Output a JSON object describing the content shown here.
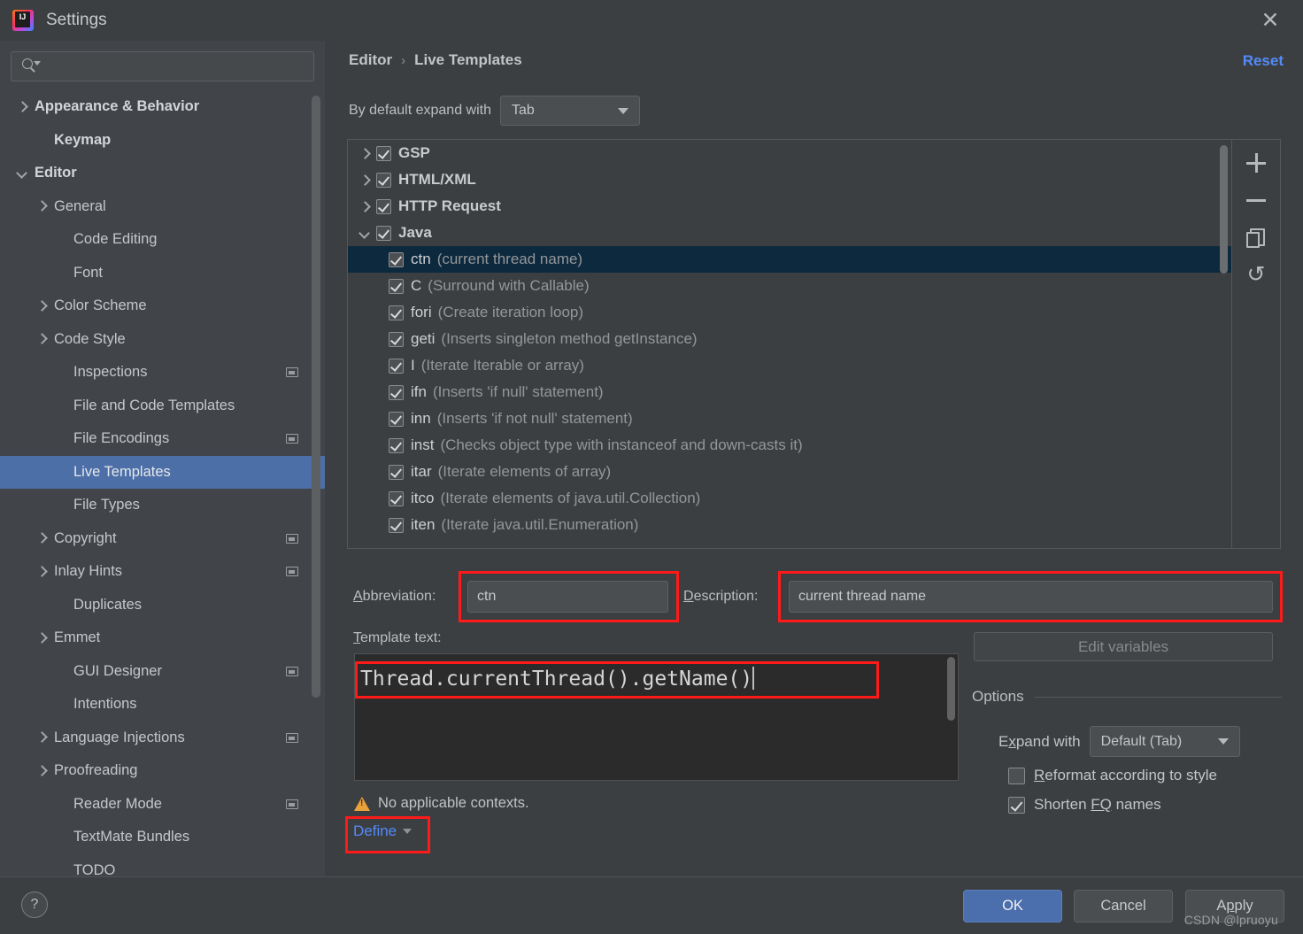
{
  "window": {
    "title": "Settings",
    "logo_text": "IJ",
    "close_icon": "✕"
  },
  "sidebar": {
    "search": {
      "value": "",
      "placeholder": ""
    },
    "items": [
      {
        "label": "Appearance & Behavior",
        "arrow": "right",
        "bold": true,
        "indent": 0,
        "badge": false,
        "selected": false
      },
      {
        "label": "Keymap",
        "arrow": "none",
        "bold": true,
        "indent": 1,
        "badge": false,
        "selected": false
      },
      {
        "label": "Editor",
        "arrow": "down",
        "bold": true,
        "indent": 0,
        "badge": false,
        "selected": false
      },
      {
        "label": "General",
        "arrow": "right",
        "bold": false,
        "indent": 1,
        "badge": false,
        "selected": false
      },
      {
        "label": "Code Editing",
        "arrow": "none",
        "bold": false,
        "indent": 2,
        "badge": false,
        "selected": false
      },
      {
        "label": "Font",
        "arrow": "none",
        "bold": false,
        "indent": 2,
        "badge": false,
        "selected": false
      },
      {
        "label": "Color Scheme",
        "arrow": "right",
        "bold": false,
        "indent": 1,
        "badge": false,
        "selected": false
      },
      {
        "label": "Code Style",
        "arrow": "right",
        "bold": false,
        "indent": 1,
        "badge": false,
        "selected": false
      },
      {
        "label": "Inspections",
        "arrow": "none",
        "bold": false,
        "indent": 2,
        "badge": true,
        "selected": false
      },
      {
        "label": "File and Code Templates",
        "arrow": "none",
        "bold": false,
        "indent": 2,
        "badge": false,
        "selected": false
      },
      {
        "label": "File Encodings",
        "arrow": "none",
        "bold": false,
        "indent": 2,
        "badge": true,
        "selected": false
      },
      {
        "label": "Live Templates",
        "arrow": "none",
        "bold": false,
        "indent": 2,
        "badge": false,
        "selected": true
      },
      {
        "label": "File Types",
        "arrow": "none",
        "bold": false,
        "indent": 2,
        "badge": false,
        "selected": false
      },
      {
        "label": "Copyright",
        "arrow": "right",
        "bold": false,
        "indent": 1,
        "badge": true,
        "selected": false
      },
      {
        "label": "Inlay Hints",
        "arrow": "right",
        "bold": false,
        "indent": 1,
        "badge": true,
        "selected": false
      },
      {
        "label": "Duplicates",
        "arrow": "none",
        "bold": false,
        "indent": 2,
        "badge": false,
        "selected": false
      },
      {
        "label": "Emmet",
        "arrow": "right",
        "bold": false,
        "indent": 1,
        "badge": false,
        "selected": false
      },
      {
        "label": "GUI Designer",
        "arrow": "none",
        "bold": false,
        "indent": 2,
        "badge": true,
        "selected": false
      },
      {
        "label": "Intentions",
        "arrow": "none",
        "bold": false,
        "indent": 2,
        "badge": false,
        "selected": false
      },
      {
        "label": "Language Injections",
        "arrow": "right",
        "bold": false,
        "indent": 1,
        "badge": true,
        "selected": false
      },
      {
        "label": "Proofreading",
        "arrow": "right",
        "bold": false,
        "indent": 1,
        "badge": false,
        "selected": false
      },
      {
        "label": "Reader Mode",
        "arrow": "none",
        "bold": false,
        "indent": 2,
        "badge": true,
        "selected": false
      },
      {
        "label": "TextMate Bundles",
        "arrow": "none",
        "bold": false,
        "indent": 2,
        "badge": false,
        "selected": false
      },
      {
        "label": "TODO",
        "arrow": "none",
        "bold": false,
        "indent": 2,
        "badge": false,
        "selected": false
      }
    ]
  },
  "main": {
    "breadcrumb": {
      "root": "Editor",
      "separator": "›",
      "leaf": "Live Templates"
    },
    "reset_label": "Reset",
    "default_expand": {
      "label": "By default expand with",
      "value": "Tab"
    },
    "templates": [
      {
        "name": "GSP",
        "desc": "",
        "arrow": "right",
        "child": false,
        "checked": true,
        "selected": false
      },
      {
        "name": "HTML/XML",
        "desc": "",
        "arrow": "right",
        "child": false,
        "checked": true,
        "selected": false
      },
      {
        "name": "HTTP Request",
        "desc": "",
        "arrow": "right",
        "child": false,
        "checked": true,
        "selected": false
      },
      {
        "name": "Java",
        "desc": "",
        "arrow": "down",
        "child": false,
        "checked": true,
        "selected": false
      },
      {
        "name": "ctn",
        "desc": "(current thread name)",
        "arrow": "none",
        "child": true,
        "checked": true,
        "selected": true
      },
      {
        "name": "C",
        "desc": "(Surround with Callable)",
        "arrow": "none",
        "child": true,
        "checked": true,
        "selected": false
      },
      {
        "name": "fori",
        "desc": "(Create iteration loop)",
        "arrow": "none",
        "child": true,
        "checked": true,
        "selected": false
      },
      {
        "name": "geti",
        "desc": "(Inserts singleton method getInstance)",
        "arrow": "none",
        "child": true,
        "checked": true,
        "selected": false
      },
      {
        "name": "I",
        "desc": "(Iterate Iterable or array)",
        "arrow": "none",
        "child": true,
        "checked": true,
        "selected": false
      },
      {
        "name": "ifn",
        "desc": "(Inserts 'if null' statement)",
        "arrow": "none",
        "child": true,
        "checked": true,
        "selected": false
      },
      {
        "name": "inn",
        "desc": "(Inserts 'if not null' statement)",
        "arrow": "none",
        "child": true,
        "checked": true,
        "selected": false
      },
      {
        "name": "inst",
        "desc": "(Checks object type with instanceof and down-casts it)",
        "arrow": "none",
        "child": true,
        "checked": true,
        "selected": false
      },
      {
        "name": "itar",
        "desc": "(Iterate elements of array)",
        "arrow": "none",
        "child": true,
        "checked": true,
        "selected": false
      },
      {
        "name": "itco",
        "desc": "(Iterate elements of java.util.Collection)",
        "arrow": "none",
        "child": true,
        "checked": true,
        "selected": false
      },
      {
        "name": "iten",
        "desc": "(Iterate java.util.Enumeration)",
        "arrow": "none",
        "child": true,
        "checked": true,
        "selected": false
      }
    ],
    "toolbar": {
      "add": "+",
      "remove": "−",
      "duplicate": "copy-icon",
      "revert": "↺"
    },
    "abbreviation": {
      "label_pre": "A",
      "label_accel": "b",
      "label_post": "breviation:",
      "value": "ctn"
    },
    "description": {
      "label_accel": "D",
      "label_post": "escription:",
      "value": "current thread name"
    },
    "template_text": {
      "label_accel": "T",
      "label_post": "emplate text:",
      "value": "Thread.currentThread().getName()"
    },
    "edit_variables_label": "Edit variables",
    "options": {
      "title": "Options",
      "expand_with": {
        "label_pre": "E",
        "label_accel": "x",
        "label_post": "pand with",
        "value": "Default (Tab)"
      },
      "reformat": {
        "accel": "R",
        "rest": "eformat according to style",
        "checked": false
      },
      "shorten": {
        "pre": "Shorten ",
        "accel": "FQ",
        "rest": " names",
        "checked": true
      }
    },
    "context_warning": "No applicable contexts.",
    "define_label": "Define"
  },
  "footer": {
    "help_label": "?",
    "ok_label": "OK",
    "cancel_label": "Cancel",
    "apply_pre": "A",
    "apply_accel": "p",
    "apply_label": "Apply",
    "watermark": "CSDN @lpruoyu"
  },
  "colors": {
    "window_bg": "#3C3F41",
    "sidebar_bg": "#41454A",
    "sidebar_selection": "#4C6FA8",
    "tree_selection": "#0D293E",
    "accent_link": "#548AF7",
    "primary_button": "#4B6EAC",
    "annotation_red": "#FF1A1A",
    "warning_amber": "#E9A13B",
    "code_bg": "#2B2B2B"
  }
}
